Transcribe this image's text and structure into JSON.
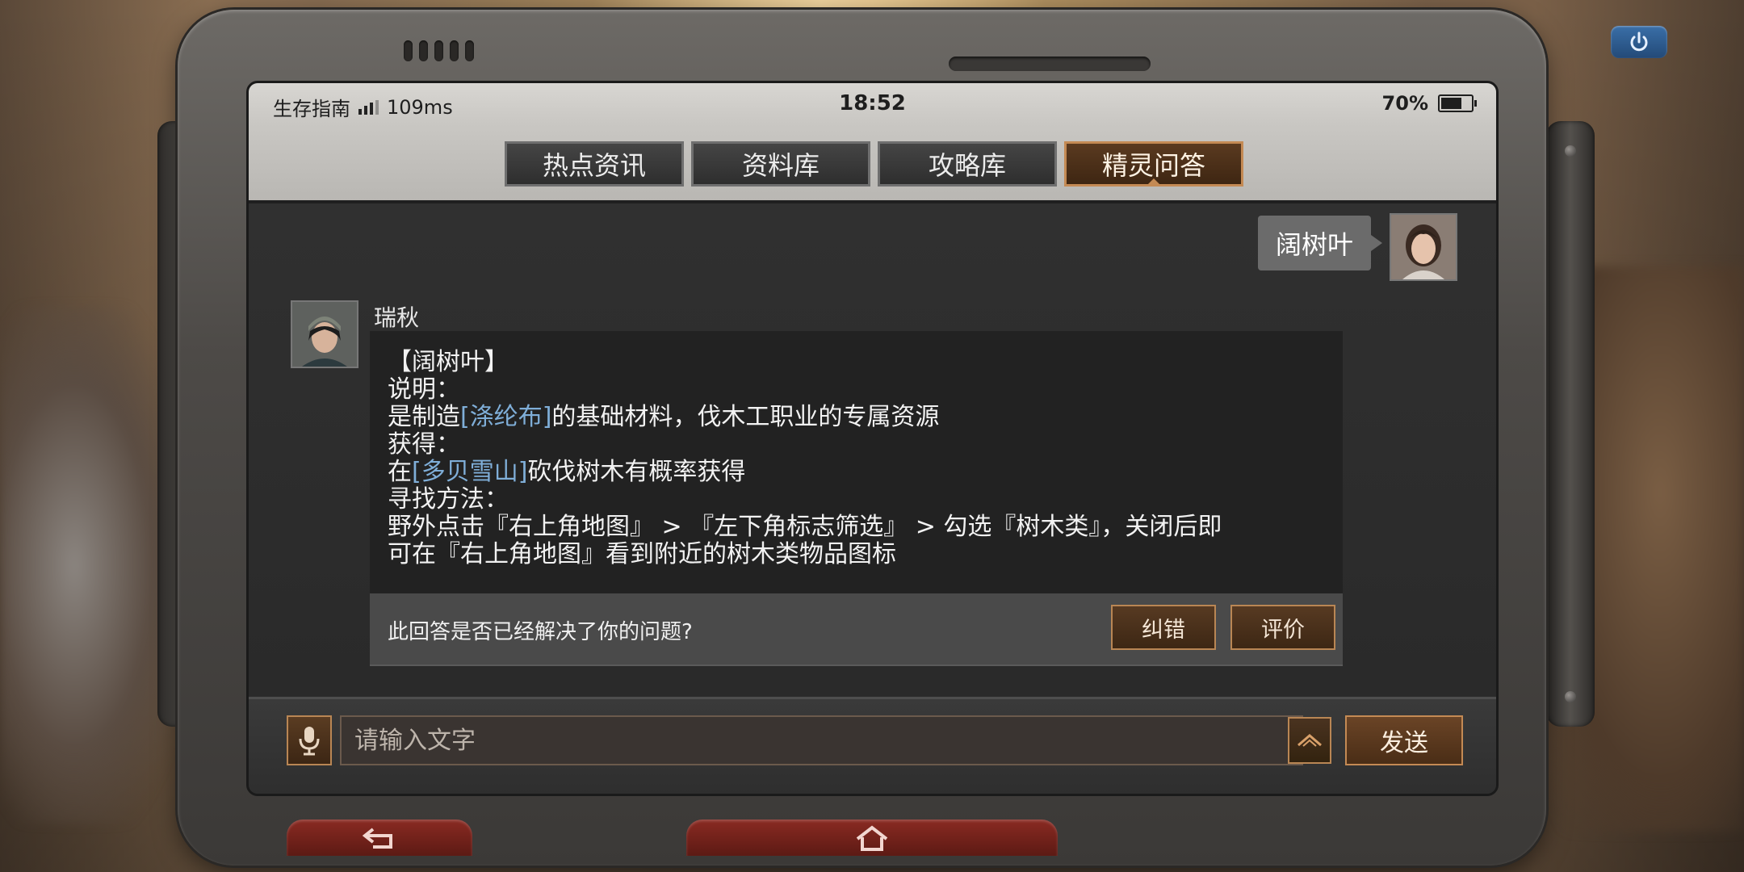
{
  "statusbar": {
    "app_label": "生存指南",
    "ping": "109ms",
    "time": "18:52",
    "battery_pct": "70%",
    "battery_level": 0.7
  },
  "tabs": [
    {
      "label": "热点资讯",
      "active": false
    },
    {
      "label": "资料库",
      "active": false
    },
    {
      "label": "攻略库",
      "active": false
    },
    {
      "label": "精灵问答",
      "active": true
    }
  ],
  "chat": {
    "user_message": "阔树叶",
    "bot_name": "瑞秋",
    "bot_lines": {
      "title": "【阔树叶】",
      "desc_label": "说明：",
      "desc_pre": "是制造",
      "desc_link": "[涤纶布]",
      "desc_post": "的基础材料，伐木工职业的专属资源",
      "obtain_label": "获得：",
      "obtain_pre": "在",
      "obtain_link": "[多贝雪山]",
      "obtain_post": "砍伐树木有概率获得",
      "find_label": "寻找方法：",
      "find_line1": "野外点击『右上角地图』 > 『左下角标志筛选』 > 勾选『树木类』，关闭后即",
      "find_line2": "可在『右上角地图』看到附近的树木类物品图标"
    },
    "feedback_question": "此回答是否已经解决了你的问题?",
    "correct_button": "纠错",
    "rate_button": "评价"
  },
  "input": {
    "placeholder": "请输入文字",
    "send_button": "发送"
  },
  "colors": {
    "accent_border": "#c48a54",
    "link": "#7faed8",
    "nav_red": "#8a2a22"
  },
  "icons": [
    "signal-icon",
    "battery-icon",
    "power-icon",
    "microphone-icon",
    "expand-up-icon",
    "back-arrow-icon",
    "home-icon"
  ]
}
